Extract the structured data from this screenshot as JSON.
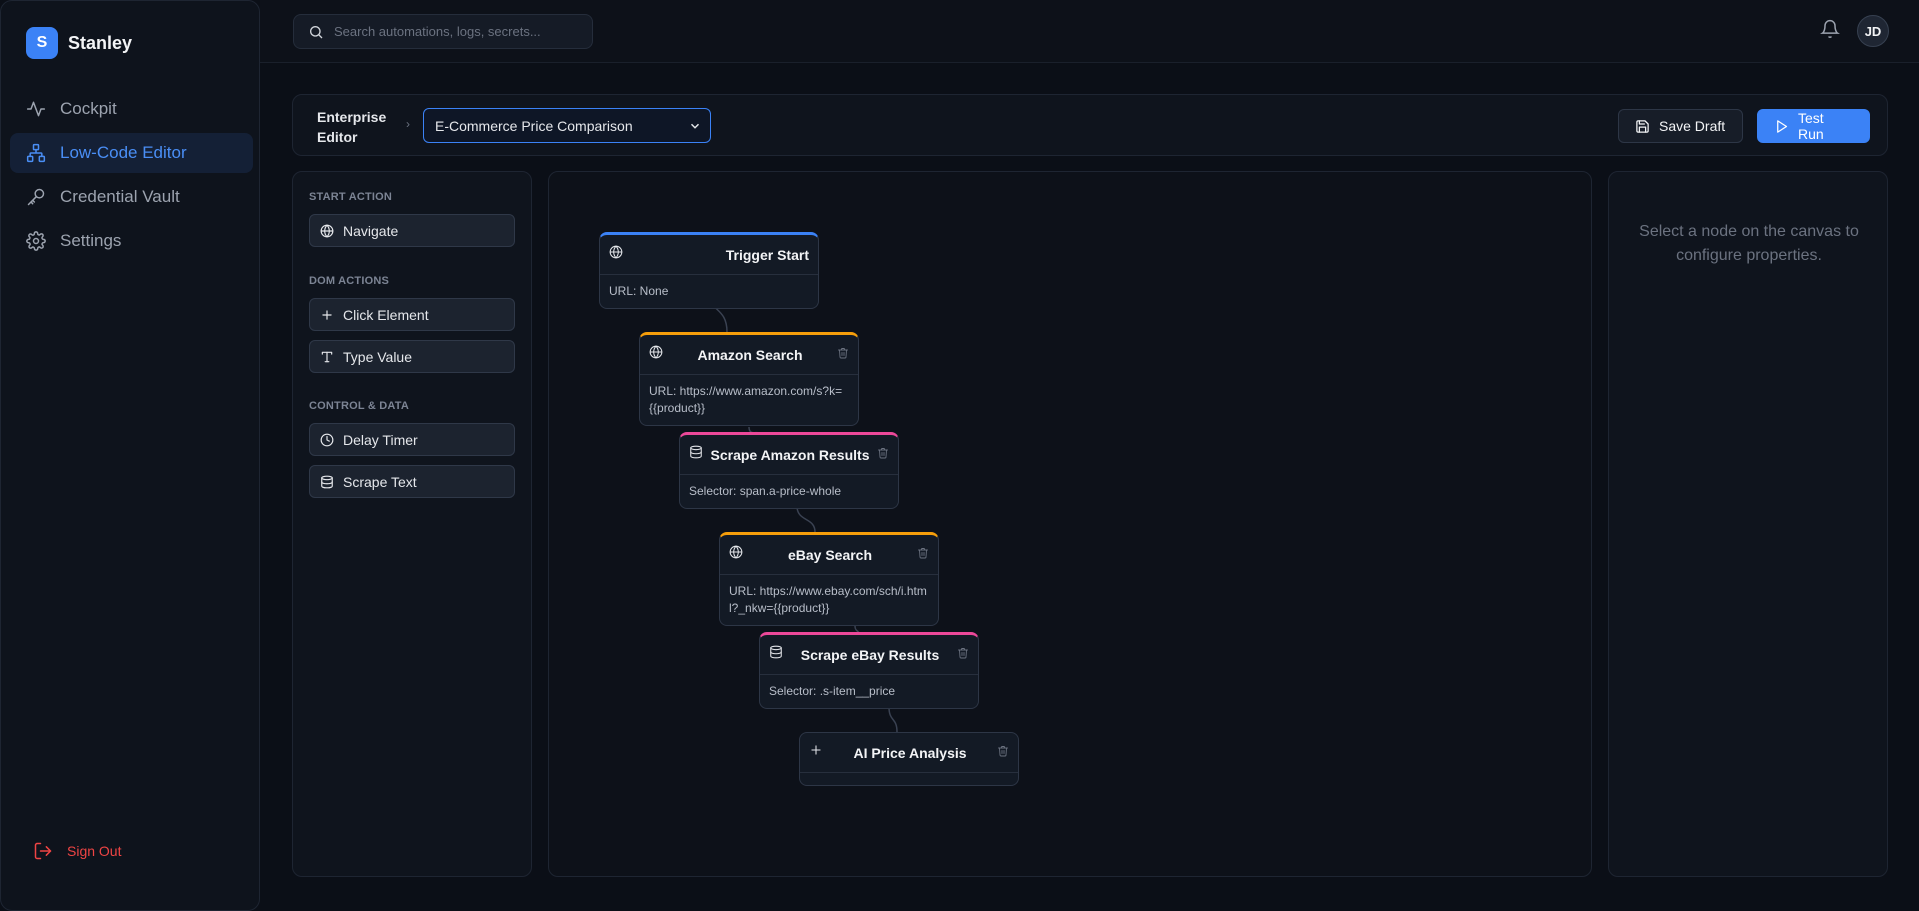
{
  "brand": {
    "logo_letter": "S",
    "name": "Stanley",
    "accent": "#3b82f6"
  },
  "sidebar": {
    "items": [
      {
        "label": "Cockpit",
        "icon": "activity-icon",
        "active": false
      },
      {
        "label": "Low-Code Editor",
        "icon": "workflow-icon",
        "active": true
      },
      {
        "label": "Credential Vault",
        "icon": "key-icon",
        "active": false
      },
      {
        "label": "Settings",
        "icon": "gear-icon",
        "active": false
      }
    ],
    "sign_out": "Sign Out"
  },
  "topbar": {
    "search_placeholder": "Search automations, logs, secrets...",
    "avatar_initials": "JD"
  },
  "editor": {
    "breadcrumb_root": "Enterprise Editor",
    "selected_workflow": "E-Commerce Price Comparison",
    "save_label": "Save Draft",
    "run_label": "Test Run"
  },
  "palette": {
    "sections": [
      {
        "title": "START ACTION",
        "items": [
          {
            "label": "Navigate",
            "icon": "globe-icon"
          }
        ]
      },
      {
        "title": "DOM ACTIONS",
        "items": [
          {
            "label": "Click Element",
            "icon": "plus-icon"
          },
          {
            "label": "Type Value",
            "icon": "text-icon"
          }
        ]
      },
      {
        "title": "CONTROL & DATA",
        "items": [
          {
            "label": "Delay Timer",
            "icon": "clock-icon"
          },
          {
            "label": "Scrape Text",
            "icon": "database-icon"
          }
        ]
      }
    ]
  },
  "nodes": [
    {
      "title": "Trigger Start",
      "body": "URL: None",
      "icon": "globe-icon",
      "accent": "#3b82f6",
      "deletable": false
    },
    {
      "title": "Amazon Search",
      "body": "URL: https://www.amazon.com/s?k={{product}}",
      "icon": "globe-icon",
      "accent": "#f59e0b",
      "deletable": true
    },
    {
      "title": "Scrape Amazon Results",
      "body": "Selector: span.a-price-whole",
      "icon": "database-icon",
      "accent": "#ec4899",
      "deletable": true
    },
    {
      "title": "eBay Search",
      "body": "URL: https://www.ebay.com/sch/i.html?_nkw={{product}}",
      "icon": "globe-icon",
      "accent": "#f59e0b",
      "deletable": true
    },
    {
      "title": "Scrape eBay Results",
      "body": "Selector: .s-item__price",
      "icon": "database-icon",
      "accent": "#ec4899",
      "deletable": true
    },
    {
      "title": "AI Price Analysis",
      "body": "",
      "icon": "plus-icon",
      "accent": "#2d3646",
      "deletable": true
    }
  ],
  "properties": {
    "empty_text": "Select a node on the canvas to configure properties."
  },
  "colors": {
    "danger": "#ef4444",
    "background": "#0b0f17"
  }
}
